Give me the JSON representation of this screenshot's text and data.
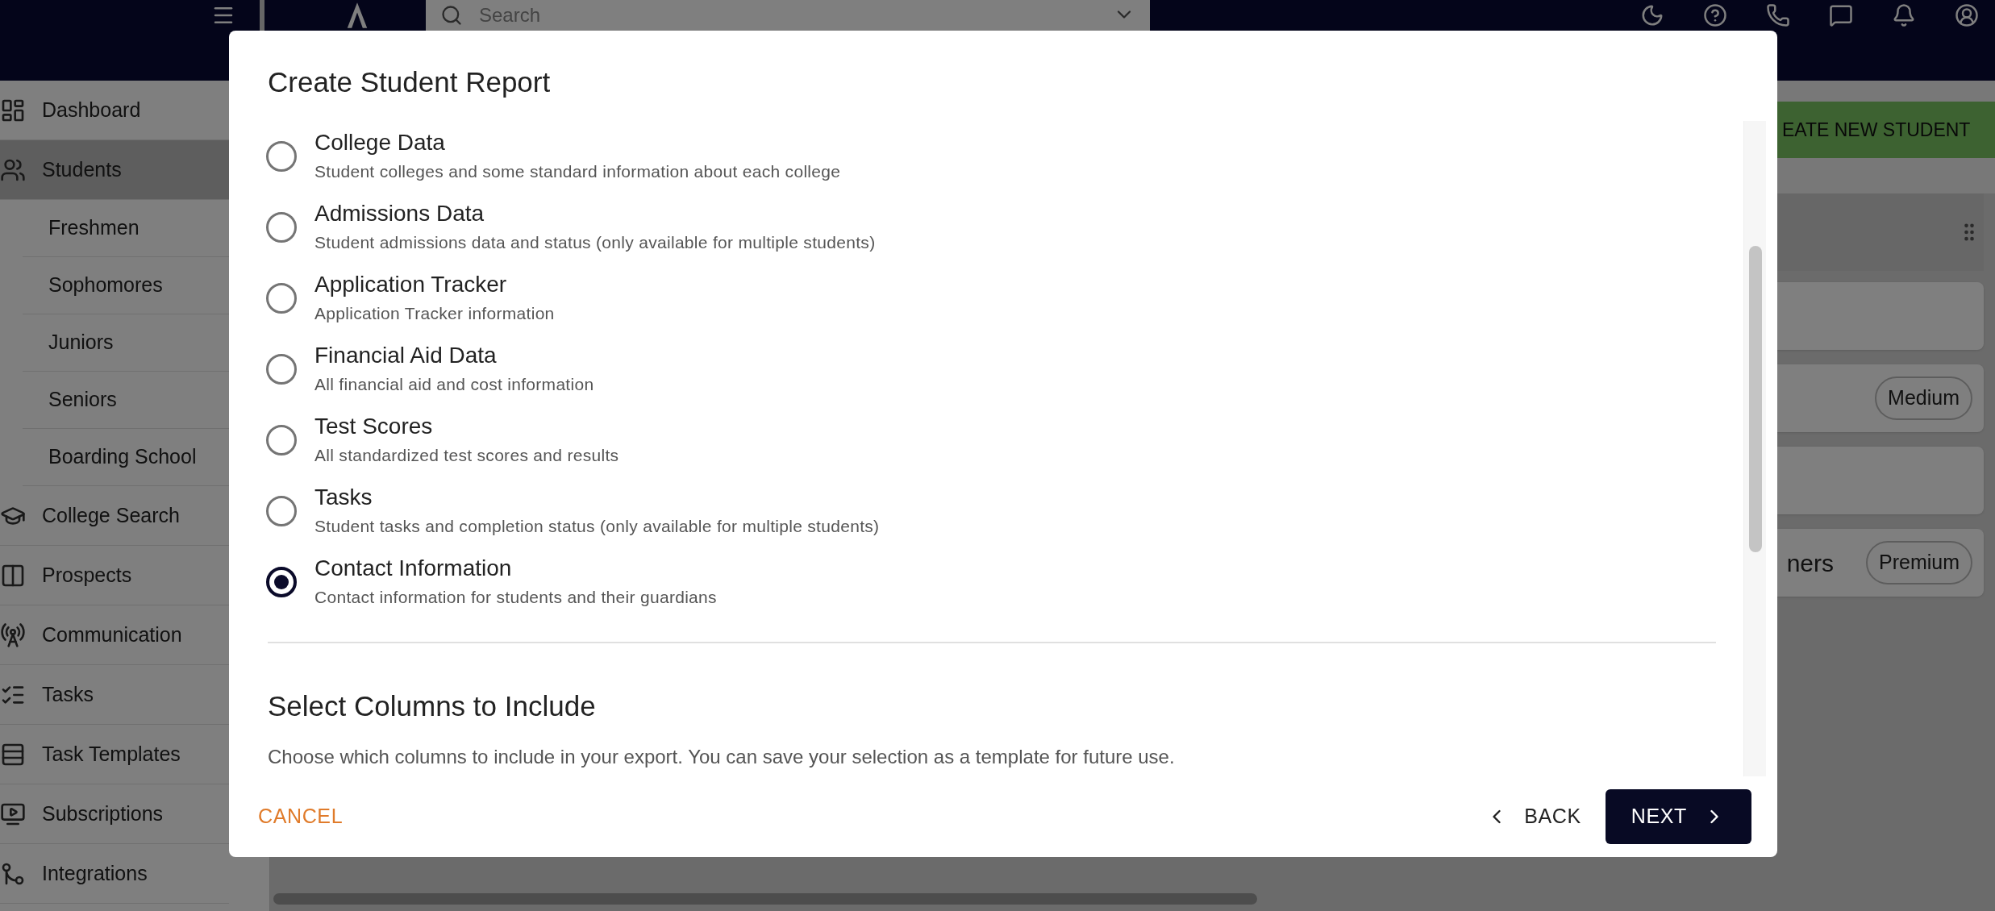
{
  "topbar": {
    "search": {
      "placeholder": "Search"
    }
  },
  "sidebar": {
    "items": [
      {
        "label": "Dashboard",
        "selected": false
      },
      {
        "label": "Students",
        "selected": true,
        "children": [
          {
            "label": "Freshmen",
            "selected": false
          },
          {
            "label": "Sophomores",
            "selected": false
          },
          {
            "label": "Juniors",
            "selected": false
          },
          {
            "label": "Seniors",
            "selected": false
          },
          {
            "label": "Boarding School",
            "selected": false
          }
        ]
      },
      {
        "label": "College Search",
        "selected": false
      },
      {
        "label": "Prospects",
        "selected": false
      },
      {
        "label": "Communication",
        "selected": false
      },
      {
        "label": "Tasks",
        "selected": false
      },
      {
        "label": "Task Templates",
        "selected": false
      },
      {
        "label": "Subscriptions",
        "selected": false
      },
      {
        "label": "Integrations",
        "selected": false
      }
    ]
  },
  "main": {
    "create_button": "EATE NEW STUDENT",
    "cards": [
      {
        "badge": "Medium"
      },
      {
        "title": "ners",
        "badge": "Premium"
      }
    ]
  },
  "dialog": {
    "title": "Create Student Report",
    "options": [
      {
        "label": "College Data",
        "description": "Student colleges and some standard information about each college",
        "selected": false
      },
      {
        "label": "Admissions Data",
        "description": "Student admissions data and status (only available for multiple students)",
        "selected": false
      },
      {
        "label": "Application Tracker",
        "description": "Application Tracker information",
        "selected": false
      },
      {
        "label": "Financial Aid Data",
        "description": "All financial aid and cost information",
        "selected": false
      },
      {
        "label": "Test Scores",
        "description": "All standardized test scores and results",
        "selected": false
      },
      {
        "label": "Tasks",
        "description": "Student tasks and completion status (only available for multiple students)",
        "selected": false
      },
      {
        "label": "Contact Information",
        "description": "Contact information for students and their guardians",
        "selected": true
      }
    ],
    "section": {
      "title": "Select Columns to Include",
      "description": "Choose which columns to include in your export. You can save your selection as a template for future use."
    },
    "buttons": {
      "cancel": "CANCEL",
      "back": "BACK",
      "next": "NEXT"
    }
  }
}
